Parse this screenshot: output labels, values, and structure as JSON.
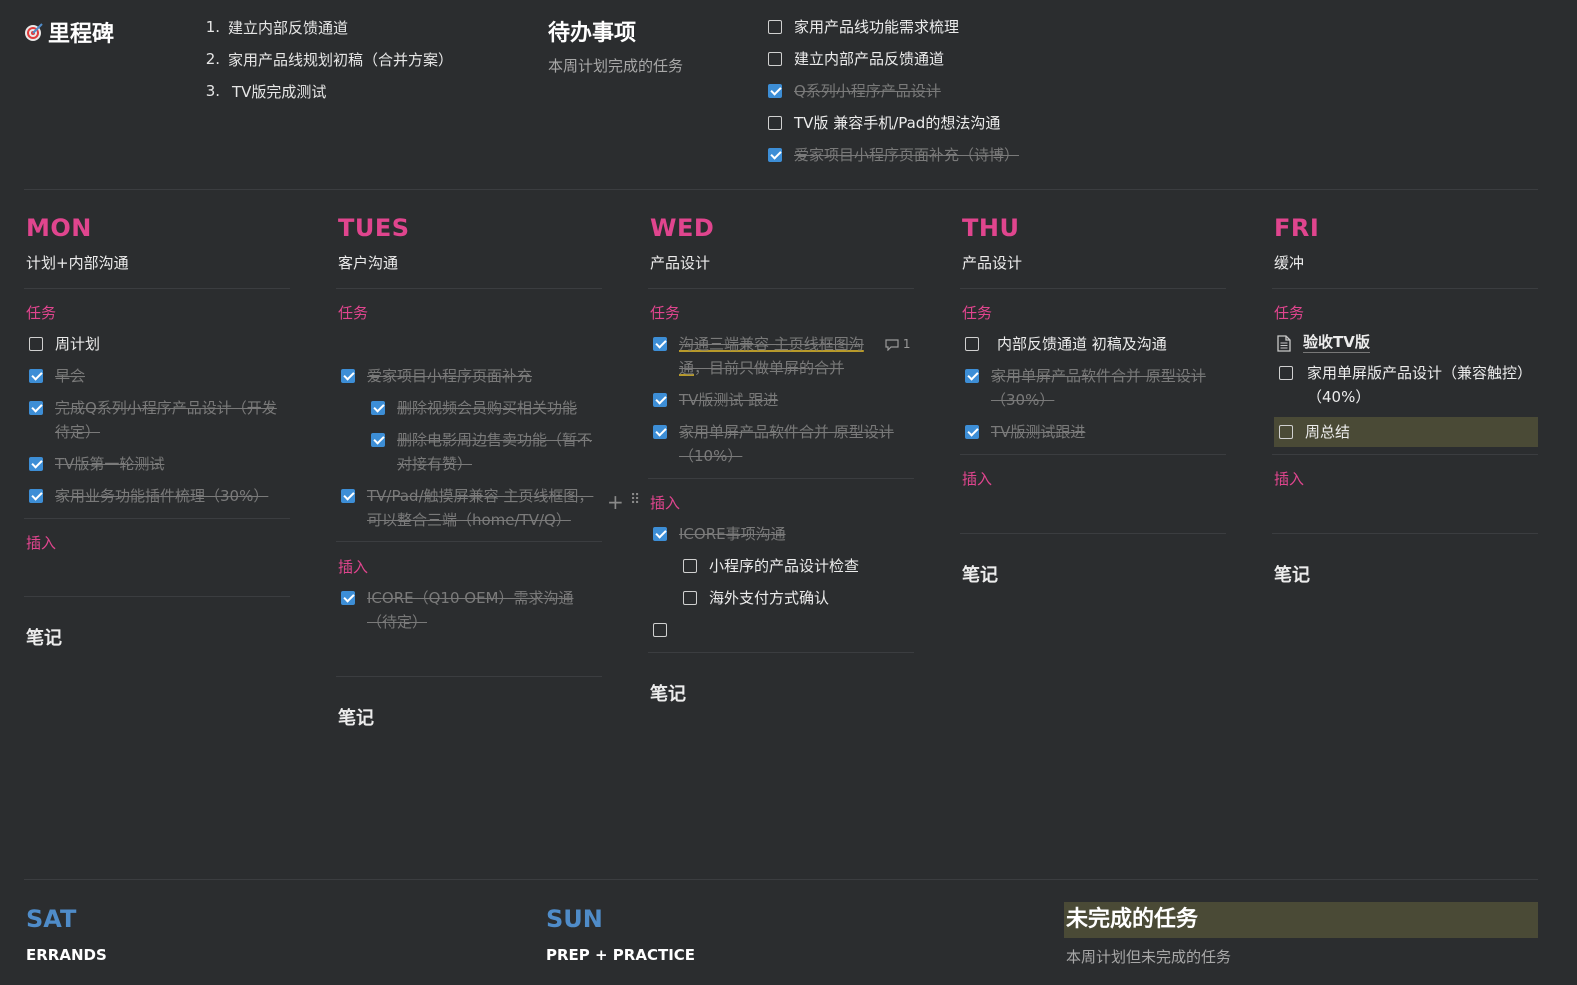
{
  "milestones": {
    "title": "里程碑",
    "items": [
      {
        "num": "1.",
        "text": "建立内部反馈通道"
      },
      {
        "num": "2.",
        "text": "家用产品线规划初稿（合并方案）"
      },
      {
        "num": "3.",
        "text": "TV版完成测试"
      }
    ]
  },
  "todo": {
    "title": "待办事项",
    "subtitle": "本周计划完成的任务",
    "items": [
      {
        "text": "家用产品线功能需求梳理",
        "checked": false
      },
      {
        "text": "建立内部产品反馈通道",
        "checked": false
      },
      {
        "text": "Q系列小程序产品设计",
        "checked": true
      },
      {
        "text": "TV版 兼容手机/Pad的想法沟通",
        "checked": false
      },
      {
        "text": "爱家项目小程序页面补充（诗博）",
        "checked": true
      }
    ]
  },
  "labels": {
    "tasks": "任务",
    "insert": "插入",
    "notes": "笔记"
  },
  "days": {
    "mon": {
      "name": "MON",
      "subtitle": "计划+内部沟通",
      "tasks": [
        {
          "text": "周计划",
          "checked": false
        },
        {
          "text": "早会",
          "checked": true
        },
        {
          "text": "完成Q系列小程序产品设计（开发待定）",
          "checked": true
        },
        {
          "text": "TV版第一轮测试",
          "checked": true
        },
        {
          "text": "家用业务功能插件梳理（30%）",
          "checked": true
        }
      ]
    },
    "tues": {
      "name": "TUES",
      "subtitle": "客户沟通",
      "tasks": [
        {
          "text": "爱家项目小程序页面补充",
          "checked": true
        },
        {
          "text": "删除视频会员购买相关功能",
          "checked": true
        },
        {
          "text": "删除电影周边售卖功能（暂不对接有赞）",
          "checked": true
        },
        {
          "text": "TV/Pad/触摸屏兼容 主页线框图，可以整合三端（home/TV/Q）",
          "checked": true
        }
      ],
      "insert_items": [
        {
          "text": "ICORE（Q10 OEM）需求沟通（待定）",
          "checked": true
        }
      ]
    },
    "wed": {
      "name": "WED",
      "subtitle": "产品设计",
      "tasks": [
        {
          "text_a": "沟通三端兼容 主页线框图沟通",
          "text_b": "，目前只做单屏的合并",
          "checked": true,
          "comment_count": "1"
        },
        {
          "text": "TV版测试 跟进",
          "checked": true
        },
        {
          "text": "家用单屏产品软件合并 原型设计（10%）",
          "checked": true
        }
      ],
      "insert_items": [
        {
          "text": "ICORE事项沟通",
          "checked": true
        },
        {
          "text": "小程序的产品设计检查",
          "checked": false
        },
        {
          "text": "海外支付方式确认",
          "checked": false
        },
        {
          "text": "",
          "checked": false
        }
      ]
    },
    "thu": {
      "name": "THU",
      "subtitle": "产品设计",
      "tasks": [
        {
          "text": "内部反馈通道 初稿及沟通",
          "checked": false
        },
        {
          "text": "家用单屏产品软件合并 原型设计（30%）",
          "checked": true
        },
        {
          "text": "TV版测试跟进",
          "checked": true
        }
      ]
    },
    "fri": {
      "name": "FRI",
      "subtitle": "缓冲",
      "tasks": [
        {
          "text": "验收TV版",
          "type": "page"
        },
        {
          "text": "家用单屏版产品设计（兼容触控）（40%）",
          "checked": false
        },
        {
          "text": "周总结",
          "checked": false
        }
      ]
    }
  },
  "weekend": {
    "sat": {
      "name": "SAT",
      "subtitle": "ERRANDS"
    },
    "sun": {
      "name": "SUN",
      "subtitle": "PREP + PRACTICE"
    },
    "unfinished": {
      "title": "未完成的任务",
      "subtitle": "本周计划但未完成的任务"
    }
  },
  "colors": {
    "pink": "#e0458e",
    "blue": "#4f8cc9",
    "checkbox": "#3d8ed6",
    "background": "#2b2d2f",
    "highlight": "#4a4a36"
  }
}
